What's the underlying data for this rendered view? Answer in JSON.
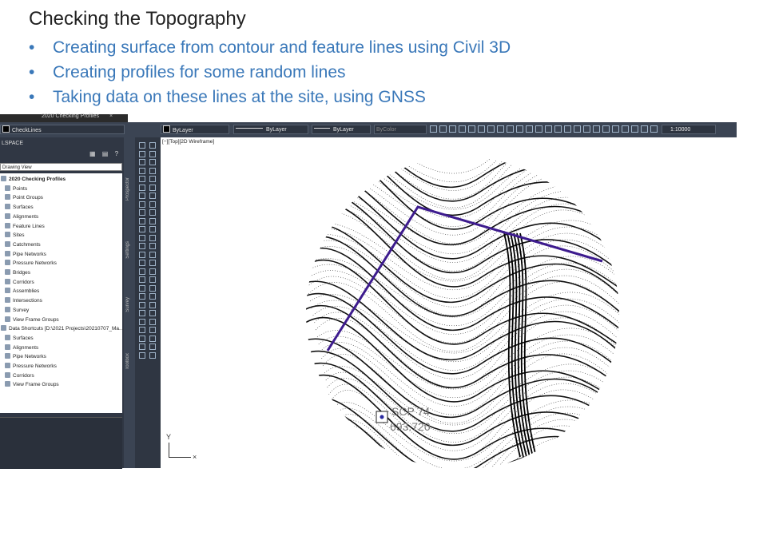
{
  "slide": {
    "title": "Checking the Topography",
    "bullets": [
      "Creating surface from contour and feature lines using Civil 3D",
      "Creating profiles for some random lines",
      "Taking data on these lines at the site, using GNSS"
    ],
    "bullet_glyph": "•"
  },
  "cad": {
    "doc_tab": "2020 Checking Profiles",
    "doc_tab_close": "×",
    "layer": "CheckLines",
    "color": "ByLayer",
    "linetype": "ByLayer",
    "lineweight": "ByLayer",
    "plotstyle": "ByColor",
    "scale": "1:10000",
    "toolspace_header": "LSPACE",
    "toolspace_view": "Drawing View",
    "tree": {
      "root": "2020 Checking Profiles",
      "items": [
        "Points",
        "Point Groups",
        "Surfaces",
        "Alignments",
        "Feature Lines",
        "Sites",
        "Catchments",
        "Pipe Networks",
        "Pressure Networks",
        "Bridges",
        "Corridors",
        "Assemblies",
        "Intersections",
        "Survey",
        "View Frame Groups"
      ],
      "shortcuts_root": "Data Shortcuts [D:\\2021 Projects\\20210707_Ma...",
      "shortcut_items": [
        "Surfaces",
        "Alignments",
        "Pipe Networks",
        "Pressure Networks",
        "Corridors",
        "View Frame Groups"
      ]
    },
    "side_tabs": [
      "Prospector",
      "Settings",
      "Survey",
      "Toolbox"
    ],
    "viewport_label": "[−][Top][2D Wireframe]",
    "point_labels": {
      "line1": "SCP 74",
      "line2": "693.720"
    },
    "ucs": {
      "y": "Y",
      "x": "×"
    },
    "colors": {
      "profile_line": "#3d1b8e",
      "bullet_text": "#3a78b9",
      "panel_bg": "#303744"
    }
  }
}
